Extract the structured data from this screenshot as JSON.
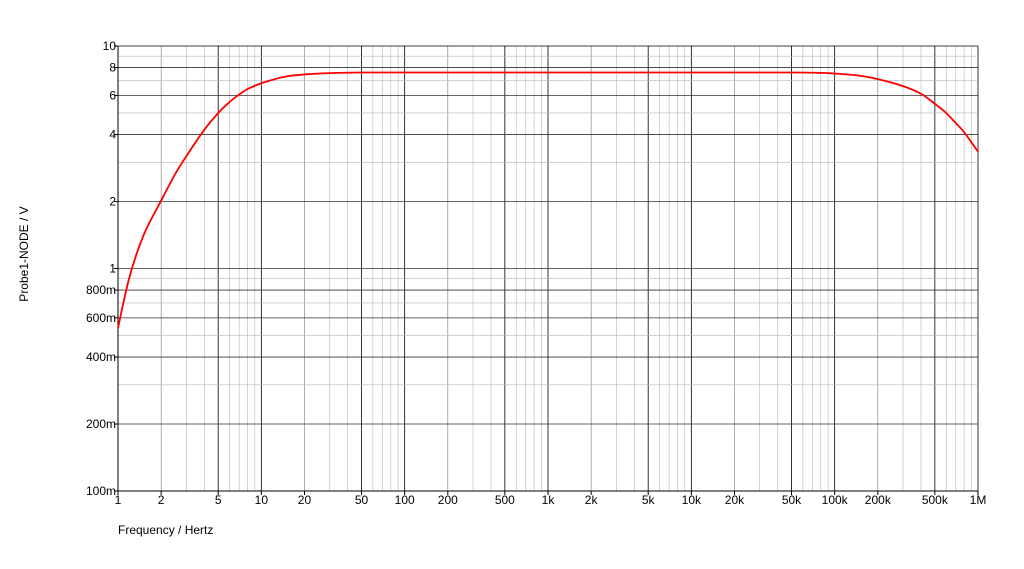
{
  "chart_data": {
    "type": "line",
    "xlabel": "Frequency / Hertz",
    "ylabel": "Probe1-NODE / V",
    "x_scale": "log",
    "y_scale": "log",
    "xlim": [
      1,
      1000000
    ],
    "ylim": [
      0.1,
      10
    ],
    "grid": true,
    "x_ticks": [
      {
        "value": 1,
        "label": "1"
      },
      {
        "value": 2,
        "label": "2"
      },
      {
        "value": 5,
        "label": "5"
      },
      {
        "value": 10,
        "label": "10"
      },
      {
        "value": 20,
        "label": "20"
      },
      {
        "value": 50,
        "label": "50"
      },
      {
        "value": 100,
        "label": "100"
      },
      {
        "value": 200,
        "label": "200"
      },
      {
        "value": 500,
        "label": "500"
      },
      {
        "value": 1000,
        "label": "1k"
      },
      {
        "value": 2000,
        "label": "2k"
      },
      {
        "value": 5000,
        "label": "5k"
      },
      {
        "value": 10000,
        "label": "10k"
      },
      {
        "value": 20000,
        "label": "20k"
      },
      {
        "value": 50000,
        "label": "50k"
      },
      {
        "value": 100000,
        "label": "100k"
      },
      {
        "value": 200000,
        "label": "200k"
      },
      {
        "value": 500000,
        "label": "500k"
      },
      {
        "value": 1000000,
        "label": "1M"
      }
    ],
    "y_ticks": [
      {
        "value": 0.1,
        "label": "100m"
      },
      {
        "value": 0.2,
        "label": "200m"
      },
      {
        "value": 0.4,
        "label": "400m"
      },
      {
        "value": 0.6,
        "label": "600m"
      },
      {
        "value": 0.8,
        "label": "800m"
      },
      {
        "value": 1,
        "label": "1"
      },
      {
        "value": 2,
        "label": "2"
      },
      {
        "value": 4,
        "label": "4"
      },
      {
        "value": 6,
        "label": "6"
      },
      {
        "value": 8,
        "label": "8"
      },
      {
        "value": 10,
        "label": "10"
      }
    ],
    "series": [
      {
        "color": "#ff0000",
        "x": [
          1,
          1.2,
          1.5,
          2,
          2.5,
          3,
          4,
          5,
          6,
          7,
          8,
          10,
          12,
          15,
          20,
          30,
          50,
          100,
          1000,
          10000,
          50000,
          80000,
          100000,
          150000,
          200000,
          300000,
          400000,
          500000,
          600000,
          700000,
          800000,
          1000000
        ],
        "values": [
          0.54,
          0.91,
          1.4,
          2.02,
          2.65,
          3.2,
          4.2,
          5.0,
          5.6,
          6.05,
          6.4,
          6.8,
          7.05,
          7.3,
          7.45,
          7.55,
          7.6,
          7.6,
          7.6,
          7.6,
          7.6,
          7.57,
          7.52,
          7.35,
          7.1,
          6.6,
          6.1,
          5.5,
          5.0,
          4.5,
          4.1,
          3.35
        ]
      }
    ]
  }
}
